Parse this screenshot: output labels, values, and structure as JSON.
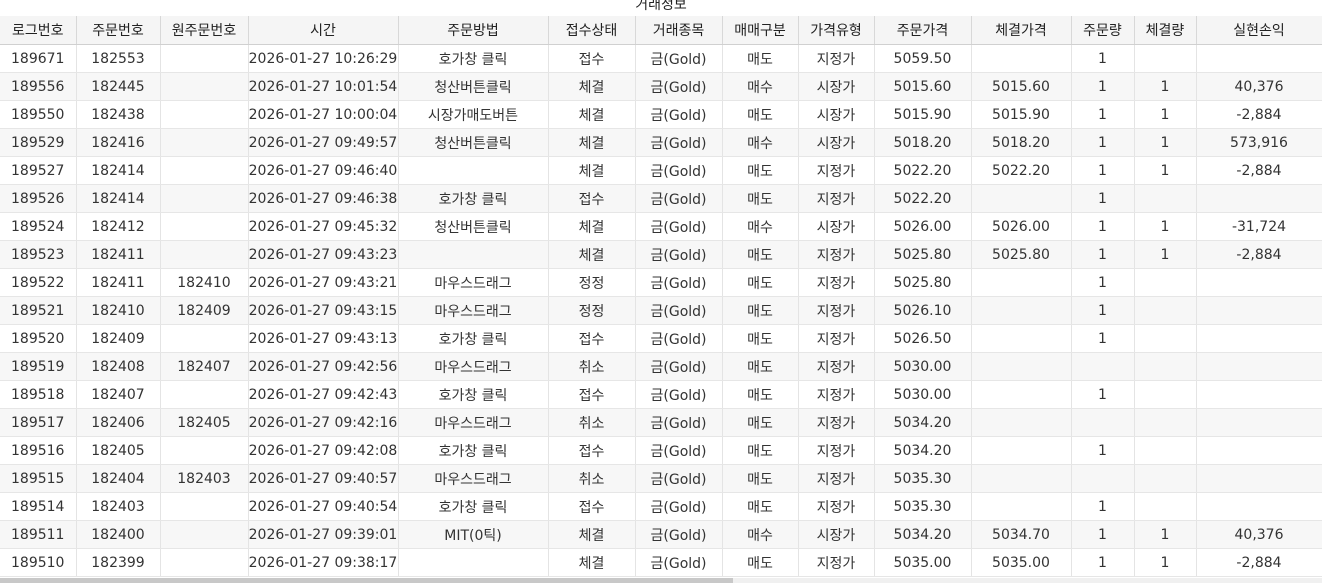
{
  "group_header": "거래정보",
  "columns": [
    "로그번호",
    "주문번호",
    "원주문번호",
    "시간",
    "주문방법",
    "접수상태",
    "거래종목",
    "매매구분",
    "가격유형",
    "주문가격",
    "체결가격",
    "주문량",
    "체결량",
    "실현손익"
  ],
  "rows": [
    {
      "log": "189671",
      "order": "182553",
      "orig": "",
      "time": "2026-01-27 10:26:29",
      "method": "호가창 클릭",
      "status": "접수",
      "item": "금(Gold)",
      "side": "매도",
      "ptype": "지정가",
      "oprice": "5059.50",
      "fprice": "",
      "oqty": "1",
      "fqty": "",
      "pnl": ""
    },
    {
      "log": "189556",
      "order": "182445",
      "orig": "",
      "time": "2026-01-27 10:01:54",
      "method": "청산버튼클릭",
      "status": "체결",
      "item": "금(Gold)",
      "side": "매수",
      "ptype": "시장가",
      "oprice": "5015.60",
      "fprice": "5015.60",
      "oqty": "1",
      "fqty": "1",
      "pnl": "40,376"
    },
    {
      "log": "189550",
      "order": "182438",
      "orig": "",
      "time": "2026-01-27 10:00:04",
      "method": "시장가매도버튼",
      "status": "체결",
      "item": "금(Gold)",
      "side": "매도",
      "ptype": "시장가",
      "oprice": "5015.90",
      "fprice": "5015.90",
      "oqty": "1",
      "fqty": "1",
      "pnl": "-2,884"
    },
    {
      "log": "189529",
      "order": "182416",
      "orig": "",
      "time": "2026-01-27 09:49:57",
      "method": "청산버튼클릭",
      "status": "체결",
      "item": "금(Gold)",
      "side": "매수",
      "ptype": "시장가",
      "oprice": "5018.20",
      "fprice": "5018.20",
      "oqty": "1",
      "fqty": "1",
      "pnl": "573,916"
    },
    {
      "log": "189527",
      "order": "182414",
      "orig": "",
      "time": "2026-01-27 09:46:40",
      "method": "",
      "status": "체결",
      "item": "금(Gold)",
      "side": "매도",
      "ptype": "지정가",
      "oprice": "5022.20",
      "fprice": "5022.20",
      "oqty": "1",
      "fqty": "1",
      "pnl": "-2,884"
    },
    {
      "log": "189526",
      "order": "182414",
      "orig": "",
      "time": "2026-01-27 09:46:38",
      "method": "호가창 클릭",
      "status": "접수",
      "item": "금(Gold)",
      "side": "매도",
      "ptype": "지정가",
      "oprice": "5022.20",
      "fprice": "",
      "oqty": "1",
      "fqty": "",
      "pnl": ""
    },
    {
      "log": "189524",
      "order": "182412",
      "orig": "",
      "time": "2026-01-27 09:45:32",
      "method": "청산버튼클릭",
      "status": "체결",
      "item": "금(Gold)",
      "side": "매수",
      "ptype": "시장가",
      "oprice": "5026.00",
      "fprice": "5026.00",
      "oqty": "1",
      "fqty": "1",
      "pnl": "-31,724"
    },
    {
      "log": "189523",
      "order": "182411",
      "orig": "",
      "time": "2026-01-27 09:43:23",
      "method": "",
      "status": "체결",
      "item": "금(Gold)",
      "side": "매도",
      "ptype": "지정가",
      "oprice": "5025.80",
      "fprice": "5025.80",
      "oqty": "1",
      "fqty": "1",
      "pnl": "-2,884"
    },
    {
      "log": "189522",
      "order": "182411",
      "orig": "182410",
      "time": "2026-01-27 09:43:21",
      "method": "마우스드래그",
      "status": "정정",
      "item": "금(Gold)",
      "side": "매도",
      "ptype": "지정가",
      "oprice": "5025.80",
      "fprice": "",
      "oqty": "1",
      "fqty": "",
      "pnl": ""
    },
    {
      "log": "189521",
      "order": "182410",
      "orig": "182409",
      "time": "2026-01-27 09:43:15",
      "method": "마우스드래그",
      "status": "정정",
      "item": "금(Gold)",
      "side": "매도",
      "ptype": "지정가",
      "oprice": "5026.10",
      "fprice": "",
      "oqty": "1",
      "fqty": "",
      "pnl": ""
    },
    {
      "log": "189520",
      "order": "182409",
      "orig": "",
      "time": "2026-01-27 09:43:13",
      "method": "호가창 클릭",
      "status": "접수",
      "item": "금(Gold)",
      "side": "매도",
      "ptype": "지정가",
      "oprice": "5026.50",
      "fprice": "",
      "oqty": "1",
      "fqty": "",
      "pnl": ""
    },
    {
      "log": "189519",
      "order": "182408",
      "orig": "182407",
      "time": "2026-01-27 09:42:56",
      "method": "마우스드래그",
      "status": "취소",
      "item": "금(Gold)",
      "side": "매도",
      "ptype": "지정가",
      "oprice": "5030.00",
      "fprice": "",
      "oqty": "",
      "fqty": "",
      "pnl": ""
    },
    {
      "log": "189518",
      "order": "182407",
      "orig": "",
      "time": "2026-01-27 09:42:43",
      "method": "호가창 클릭",
      "status": "접수",
      "item": "금(Gold)",
      "side": "매도",
      "ptype": "지정가",
      "oprice": "5030.00",
      "fprice": "",
      "oqty": "1",
      "fqty": "",
      "pnl": ""
    },
    {
      "log": "189517",
      "order": "182406",
      "orig": "182405",
      "time": "2026-01-27 09:42:16",
      "method": "마우스드래그",
      "status": "취소",
      "item": "금(Gold)",
      "side": "매도",
      "ptype": "지정가",
      "oprice": "5034.20",
      "fprice": "",
      "oqty": "",
      "fqty": "",
      "pnl": ""
    },
    {
      "log": "189516",
      "order": "182405",
      "orig": "",
      "time": "2026-01-27 09:42:08",
      "method": "호가창 클릭",
      "status": "접수",
      "item": "금(Gold)",
      "side": "매도",
      "ptype": "지정가",
      "oprice": "5034.20",
      "fprice": "",
      "oqty": "1",
      "fqty": "",
      "pnl": ""
    },
    {
      "log": "189515",
      "order": "182404",
      "orig": "182403",
      "time": "2026-01-27 09:40:57",
      "method": "마우스드래그",
      "status": "취소",
      "item": "금(Gold)",
      "side": "매도",
      "ptype": "지정가",
      "oprice": "5035.30",
      "fprice": "",
      "oqty": "",
      "fqty": "",
      "pnl": ""
    },
    {
      "log": "189514",
      "order": "182403",
      "orig": "",
      "time": "2026-01-27 09:40:54",
      "method": "호가창 클릭",
      "status": "접수",
      "item": "금(Gold)",
      "side": "매도",
      "ptype": "지정가",
      "oprice": "5035.30",
      "fprice": "",
      "oqty": "1",
      "fqty": "",
      "pnl": ""
    },
    {
      "log": "189511",
      "order": "182400",
      "orig": "",
      "time": "2026-01-27 09:39:01",
      "method": "MIT(0틱)",
      "status": "체결",
      "item": "금(Gold)",
      "side": "매수",
      "ptype": "시장가",
      "oprice": "5034.20",
      "fprice": "5034.70",
      "oqty": "1",
      "fqty": "1",
      "pnl": "40,376"
    },
    {
      "log": "189510",
      "order": "182399",
      "orig": "",
      "time": "2026-01-27 09:38:17",
      "method": "",
      "status": "체결",
      "item": "금(Gold)",
      "side": "매도",
      "ptype": "지정가",
      "oprice": "5035.00",
      "fprice": "5035.00",
      "oqty": "1",
      "fqty": "1",
      "pnl": "-2,884"
    }
  ],
  "colors": {
    "sell": "#1a1acc",
    "profit": "#e03030",
    "loss": "#1a1acc"
  }
}
